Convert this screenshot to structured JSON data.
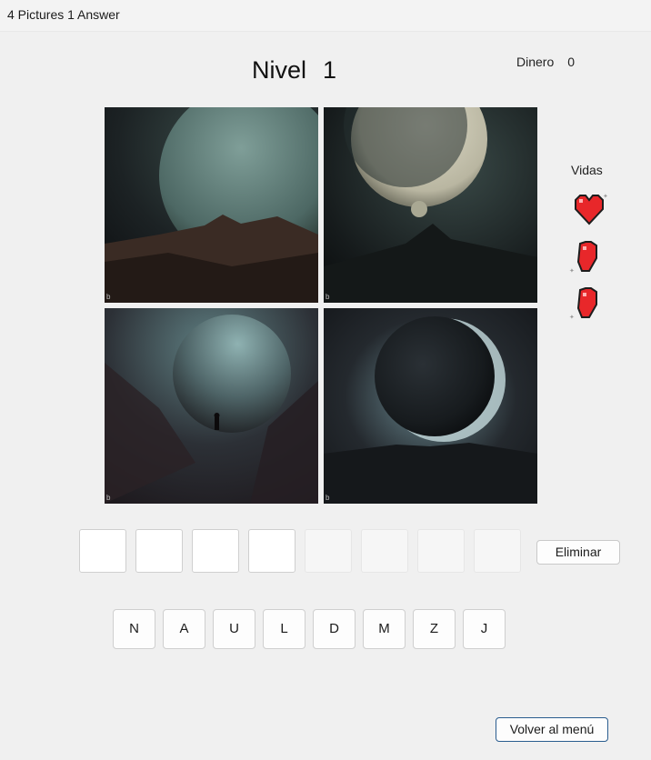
{
  "window": {
    "title": "4 Pictures 1 Answer"
  },
  "header": {
    "level_label": "Nivel",
    "level_value": "1",
    "money_label": "Dinero",
    "money_value": "0"
  },
  "lives": {
    "label": "Vidas",
    "count": 3,
    "icon": "heart-icon"
  },
  "pictures": [
    {
      "name": "moon-over-mountains",
      "watermark": "b"
    },
    {
      "name": "crescent-moon-peak",
      "watermark": "b"
    },
    {
      "name": "moon-figure-valley",
      "watermark": "b"
    },
    {
      "name": "eclipse-moon-valley",
      "watermark": "b"
    }
  ],
  "answer": {
    "slots_active": 4,
    "slots_total": 8,
    "delete_label": "Eliminar"
  },
  "letters": [
    "N",
    "A",
    "U",
    "L",
    "D",
    "M",
    "Z",
    "J"
  ],
  "footer": {
    "back_label": "Volver al menú"
  },
  "colors": {
    "heart": "#e8272a",
    "accent_border": "#2a5d8f"
  }
}
